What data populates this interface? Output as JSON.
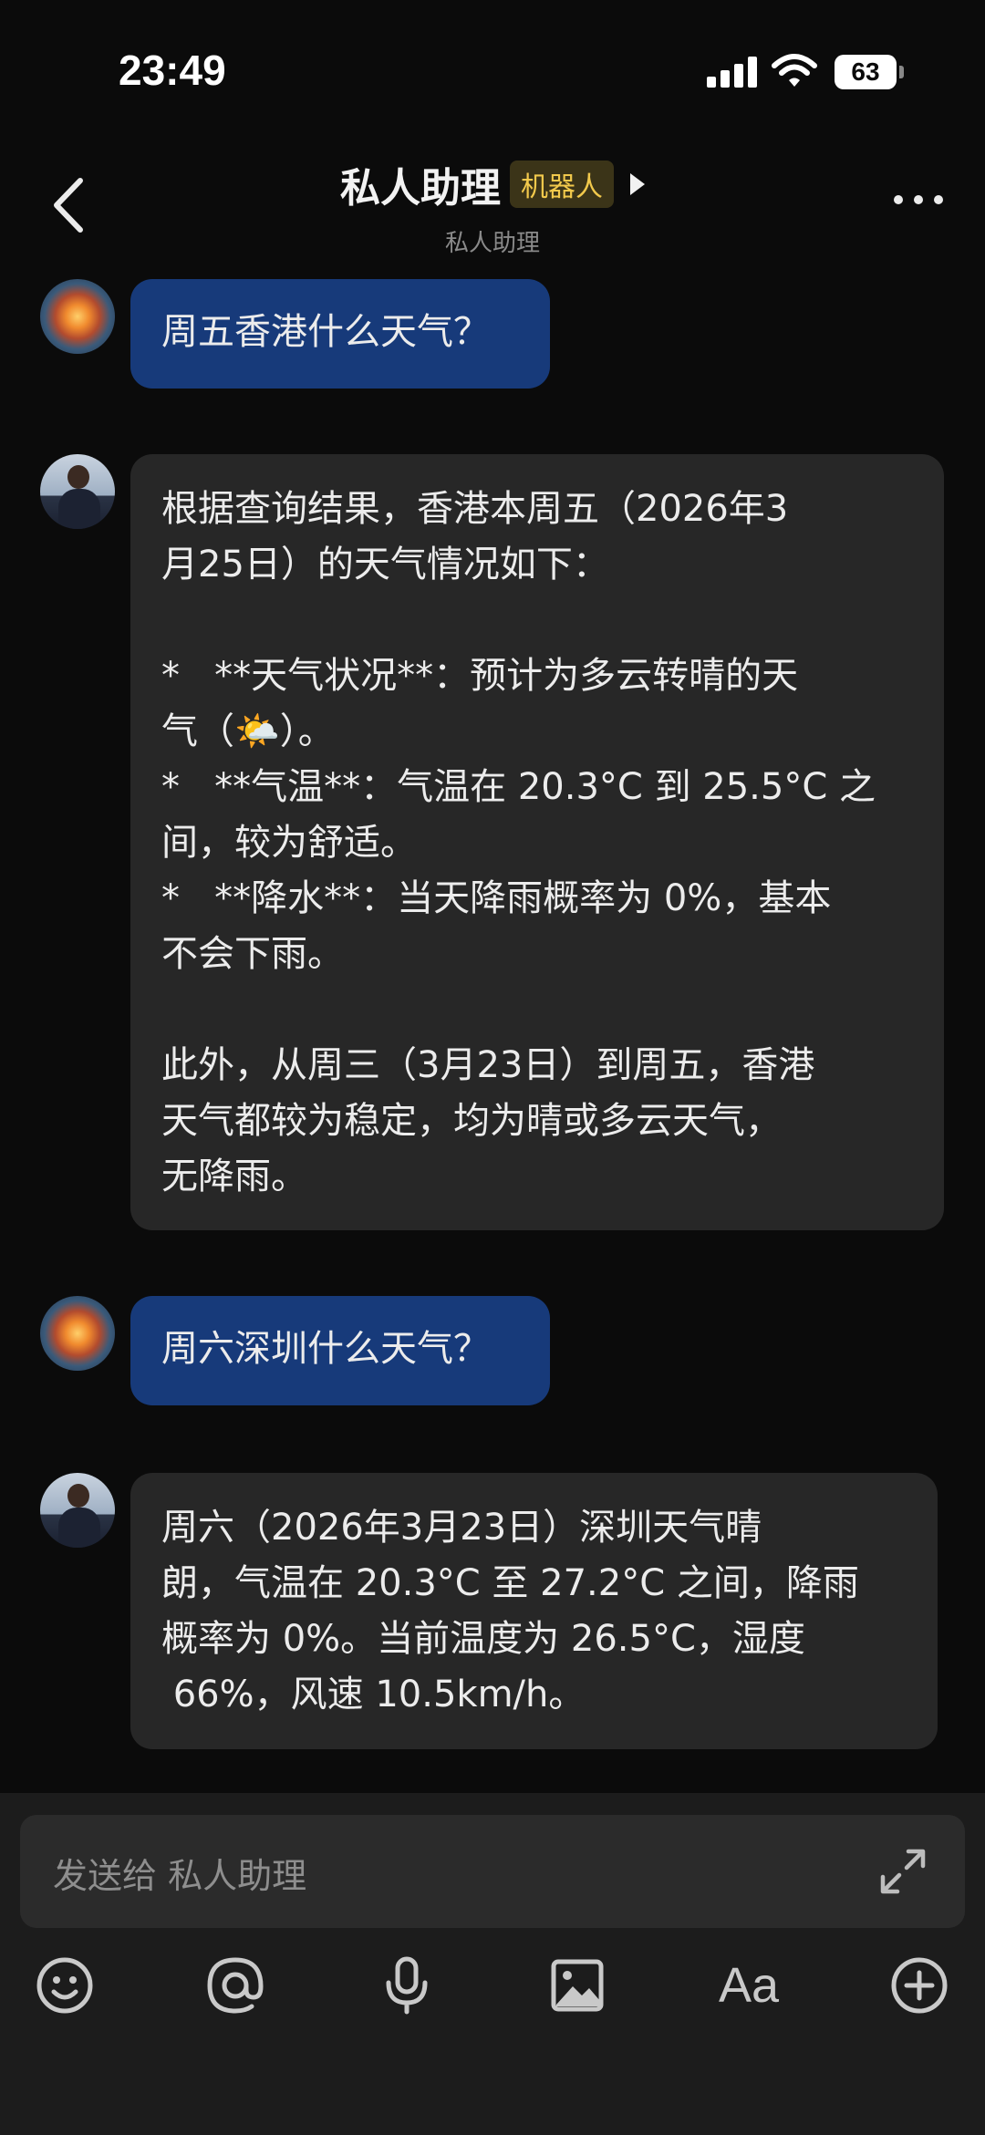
{
  "status_bar": {
    "time": "23:49",
    "battery": "63"
  },
  "header": {
    "title": "私人助理",
    "badge": "机器人",
    "subtitle": "私人助理"
  },
  "messages": [
    {
      "role": "user",
      "avatar": "sunset-avatar",
      "text": "周五香港什么天气？"
    },
    {
      "role": "bot",
      "avatar": "assistant-avatar",
      "text": "根据查询结果，香港本周五（2026年3\n月25日）的天气情况如下：\n\n*   **天气状况**：预计为多云转晴的天\n气（🌤️）。\n*   **气温**：气温在 20.3°C 到 25.5°C 之\n间，较为舒适。\n*   **降水**：当天降雨概率为 0%，基本\n不会下雨。\n\n此外，从周三（3月23日）到周五，香港\n天气都较为稳定，均为晴或多云天气，\n无降雨。"
    },
    {
      "role": "user",
      "avatar": "sunset-avatar",
      "text": "周六深圳什么天气？"
    },
    {
      "role": "bot",
      "avatar": "assistant-avatar",
      "text": "周六（2026年3月23日）深圳天气晴\n朗，气温在 20.3°C 至 27.2°C 之间，降雨\n概率为 0%。当前温度为 26.5°C，湿度\n 66%，风速 10.5km/h。"
    }
  ],
  "composer": {
    "placeholder": "发送给 私人助理",
    "tools": [
      "emoji-icon",
      "mention-icon",
      "microphone-icon",
      "image-icon",
      "font-icon",
      "add-icon"
    ],
    "font_label": "Aa"
  }
}
